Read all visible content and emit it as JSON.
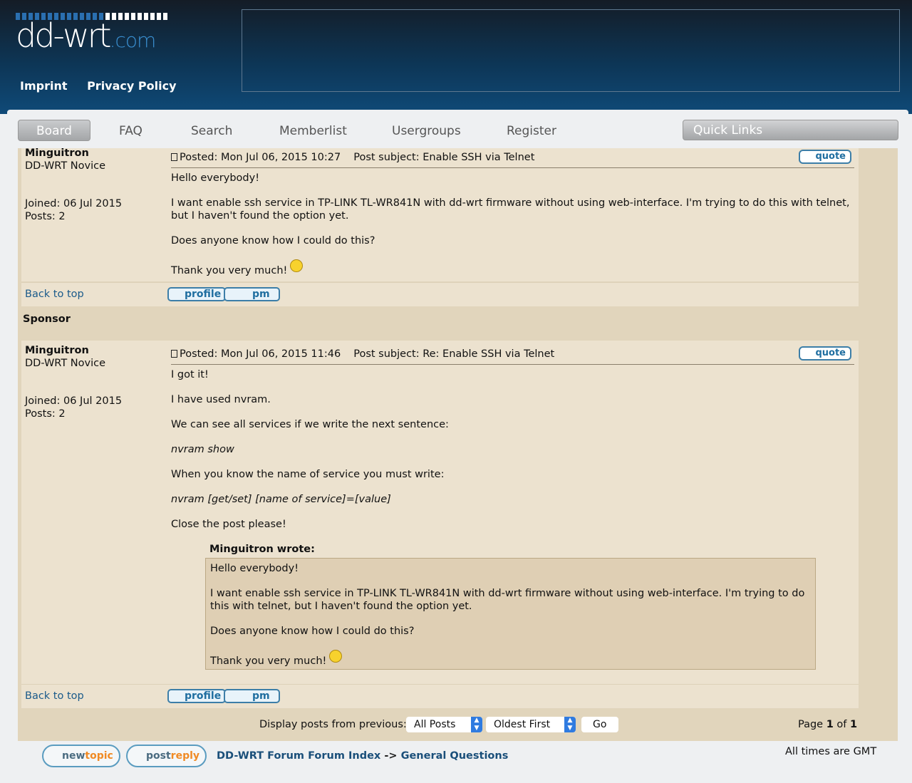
{
  "header": {
    "logo_text": "dd-wrt",
    "logo_suffix": ".com",
    "links": [
      "Imprint",
      "Privacy Policy"
    ]
  },
  "nav": {
    "items": [
      "Board",
      "FAQ",
      "Search",
      "Memberlist",
      "Usergroups",
      "Register"
    ],
    "quick_links": "Quick Links"
  },
  "posts": [
    {
      "author": "Minguitron",
      "rank": "DD-WRT Novice",
      "joined": "Joined: 06 Jul 2015",
      "posts": "Posts: 2",
      "posted": "Posted: Mon Jul 06, 2015 10:27",
      "subject": "Post subject: Enable SSH via Telnet",
      "body": [
        "Hello everybody!",
        "I want enable ssh service in TP-LINK TL-WR841N with dd-wrt firmware without using web-interface. I'm trying to do this with telnet, but I haven't found the option yet.",
        "Does anyone know how I could do this?",
        "Thank you very much!"
      ]
    },
    {
      "author": "Minguitron",
      "rank": "DD-WRT Novice",
      "joined": "Joined: 06 Jul 2015",
      "posts": "Posts: 2",
      "posted": "Posted: Mon Jul 06, 2015 11:46",
      "subject": "Post subject: Re: Enable SSH via Telnet",
      "body": [
        "I got it!",
        "I have used nvram.",
        "We can see all services if we write the next sentence:",
        "nvram show",
        "When you know the name of service you must write:",
        "nvram [get/set] [name of service]=[value]",
        "Close the post please!"
      ],
      "quote_author": "Minguitron wrote:",
      "quote_body": [
        "Hello everybody!",
        "I want enable ssh service in TP-LINK TL-WR841N with dd-wrt firmware without using web-interface. I'm trying to do this with telnet, but I haven't found the option yet.",
        "Does anyone know how I could do this?",
        "Thank you very much!"
      ]
    }
  ],
  "labels": {
    "quote": "quote",
    "profile": "profile",
    "pm": "pm",
    "back_to_top": "Back to top",
    "sponsor": "Sponsor"
  },
  "footer": {
    "display_label": "Display posts from previous:",
    "filter": "All Posts",
    "order": "Oldest First",
    "go": "Go",
    "page_prefix": "Page",
    "page_current": "1",
    "page_of": "of",
    "page_total": "1",
    "new_topic": [
      "new",
      "topic"
    ],
    "post_reply": [
      "post",
      "reply"
    ],
    "breadcrumb_index": "DD-WRT Forum Forum Index",
    "breadcrumb_sep": "->",
    "breadcrumb_current": "General Questions",
    "timezone": "All times are GMT"
  }
}
